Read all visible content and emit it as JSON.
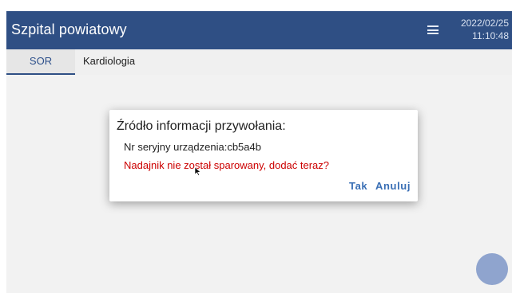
{
  "app": {
    "title": "Szpital powiatowy",
    "date": "2022/02/25",
    "time": "11:10:48"
  },
  "tabs": [
    {
      "label": "SOR",
      "active": true
    },
    {
      "label": "Kardiologia",
      "active": false
    }
  ],
  "dialog": {
    "title": "Źródło informacji przywołania:",
    "serial": "Nr seryjny urządzenia:cb5a4b",
    "warning": "Nadajnik nie został sparowany, dodać teraz?",
    "confirm_label": "Tak",
    "cancel_label": "Anuluj"
  },
  "colors": {
    "appbar": "#2f4f84",
    "accent": "#3a6fb5",
    "warning": "#cc0000",
    "fab": "#7e97c8"
  },
  "icons": {
    "menu": "hamburger-menu-icon",
    "fab": "floating-action-button"
  }
}
